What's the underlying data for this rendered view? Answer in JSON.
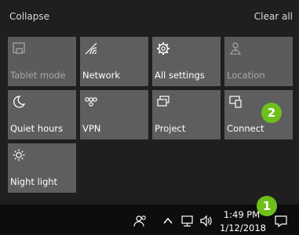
{
  "panel": {
    "collapse_label": "Collapse",
    "clear_all_label": "Clear all"
  },
  "tiles": [
    {
      "label": "Tablet mode",
      "icon": "tablet-mode-icon",
      "state": "disabled"
    },
    {
      "label": "Network",
      "icon": "network-icon",
      "state": "enabled"
    },
    {
      "label": "All settings",
      "icon": "gear-icon",
      "state": "enabled"
    },
    {
      "label": "Location",
      "icon": "location-icon",
      "state": "disabled"
    },
    {
      "label": "Quiet hours",
      "icon": "moon-icon",
      "state": "enabled"
    },
    {
      "label": "VPN",
      "icon": "vpn-icon",
      "state": "enabled"
    },
    {
      "label": "Project",
      "icon": "project-icon",
      "state": "enabled"
    },
    {
      "label": "Connect",
      "icon": "connect-icon",
      "state": "enabled"
    },
    {
      "label": "Night light",
      "icon": "night-light-icon",
      "state": "enabled"
    }
  ],
  "badges": {
    "connect_tile": "2",
    "action_center_button": "1",
    "color": "#6fbf1c"
  },
  "taskbar": {
    "time": "1:49 PM",
    "date": "1/12/2018",
    "icons": [
      "people-icon",
      "chevron-up-icon",
      "network-icon",
      "volume-icon",
      "action-center-icon"
    ]
  },
  "colors": {
    "panel_background": "#1f1f1f",
    "tile_background": "#5e5e5e",
    "taskbar_background": "#0d0d0d",
    "disabled_text": "#a9a9a9"
  }
}
